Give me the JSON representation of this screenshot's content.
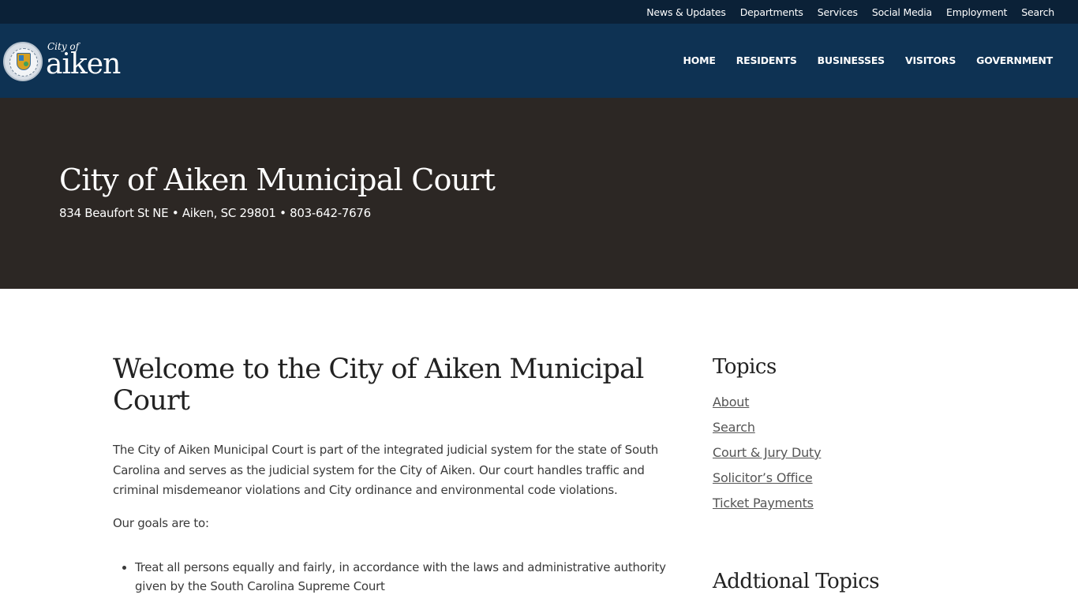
{
  "utility_nav": [
    "News & Updates",
    "Departments",
    "Services",
    "Social Media",
    "Employment",
    "Search"
  ],
  "logo": {
    "city_of": "City of",
    "name": "aiken"
  },
  "main_nav": [
    "HOME",
    "RESIDENTS",
    "BUSINESSES",
    "VISITORS",
    "GOVERNMENT"
  ],
  "hero": {
    "title": "City of Aiken Municipal Court",
    "address": "834 Beaufort St NE • Aiken, SC 29801 • 803-642-7676"
  },
  "content": {
    "heading": "Welcome to the City of Aiken Municipal Court",
    "intro": "The City of Aiken Municipal Court is part of the integrated judicial system for the state of South Carolina and serves as the judicial system for the City of Aiken. Our court handles traffic and criminal misdemeanor violations and City ordinance and environmental code violations.",
    "goals_label": "Our goals are to:",
    "goals": [
      "Treat all persons equally and fairly, in accordance with the laws and administrative authority given by the South Carolina Supreme Court"
    ]
  },
  "sidebar": {
    "topics_title": "Topics",
    "topics": [
      "About",
      "Search",
      "Court & Jury Duty",
      "Solicitor’s Office",
      "Ticket Payments"
    ],
    "additional_title": "Addtional Topics"
  },
  "colors": {
    "utility_bar": "#0b2137",
    "header": "#0e3253",
    "hero": "#2c2724",
    "link": "#555555"
  }
}
